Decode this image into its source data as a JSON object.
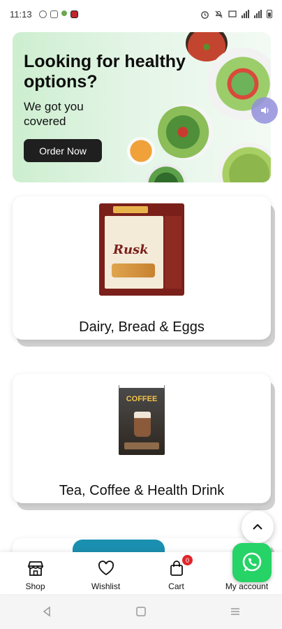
{
  "status_bar": {
    "time": "11:13"
  },
  "hero": {
    "title": "Looking for healthy options?",
    "subtitle": "We got you covered",
    "cta_label": "Order Now"
  },
  "categories": [
    {
      "label": "Dairy, Bread & Eggs",
      "image_text": "Rusk"
    },
    {
      "label": "Tea, Coffee & Health Drink",
      "image_text": "COFFEE"
    }
  ],
  "bottom_nav": {
    "items": [
      {
        "label": "Shop",
        "icon": "store-icon"
      },
      {
        "label": "Wishlist",
        "icon": "heart-icon"
      },
      {
        "label": "Cart",
        "icon": "shopping-bag-icon",
        "badge": "0"
      },
      {
        "label": "My account",
        "icon": "user-icon"
      }
    ]
  },
  "colors": {
    "hero_bg": "#cdeecf",
    "cta_bg": "#1f1f1f",
    "badge": "#e0262b",
    "whatsapp": "#25d366"
  }
}
